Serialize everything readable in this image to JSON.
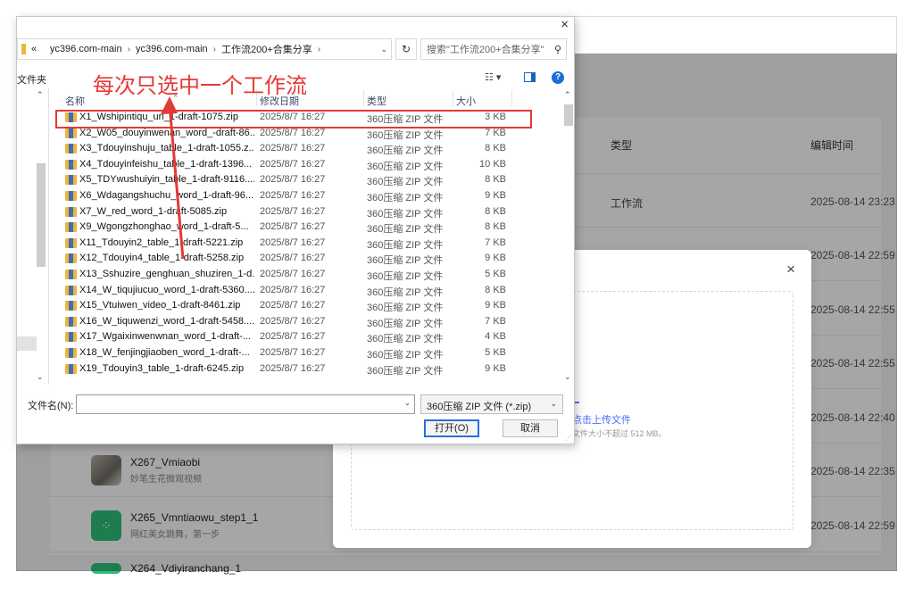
{
  "app": {
    "columns": {
      "type": "类型",
      "edit_time": "编辑时间"
    },
    "rows": [
      {
        "type": "工作流",
        "time": "2025-08-14 23:23"
      },
      {
        "type": "",
        "time": "2025-08-14 22:59"
      },
      {
        "type": "",
        "time": "2025-08-14 22:55"
      },
      {
        "type": "",
        "time": "2025-08-14 22:55"
      },
      {
        "type": "",
        "time": "2025-08-14 22:40"
      },
      {
        "type": "",
        "time": "2025-08-14 22:35"
      },
      {
        "type": "",
        "time": "2025-08-14 22:59"
      }
    ],
    "workflows": [
      {
        "title": "X267_Vmiaobi",
        "subtitle": "妙笔生花微观视频"
      },
      {
        "title": "X265_Vmntiaowu_step1_1",
        "subtitle": "网红美女跳舞，第一步"
      },
      {
        "title": "X264_Vdiyiranchang_1",
        "subtitle": ""
      }
    ]
  },
  "modal": {
    "close": "×",
    "upload_link": "点击上传文件",
    "upload_hint": "文件大小不超过 512 MB。"
  },
  "dialog": {
    "close": "×",
    "path": [
      "«",
      "yc396.com-main",
      "yc396.com-main",
      "工作流200+合集分享"
    ],
    "search_placeholder": "搜索\"工作流200+合集分享\"",
    "left_toolbar": "文件夹",
    "annotation": "每次只选中一个工作流",
    "headers": {
      "name": "名称",
      "date": "修改日期",
      "type": "类型",
      "size": "大小"
    },
    "files": [
      {
        "name": "X1_Wshipintiqu_url_1-draft-1075.zip",
        "date": "2025/8/7 16:27",
        "type": "360压缩 ZIP 文件",
        "size": "3 KB"
      },
      {
        "name": "X2_W05_douyinwenan_word_-draft-86...",
        "date": "2025/8/7 16:27",
        "type": "360压缩 ZIP 文件",
        "size": "7 KB"
      },
      {
        "name": "X3_Tdouyinshuju_table_1-draft-1055.z...",
        "date": "2025/8/7 16:27",
        "type": "360压缩 ZIP 文件",
        "size": "8 KB"
      },
      {
        "name": "X4_Tdouyinfeishu_table_1-draft-1396...",
        "date": "2025/8/7 16:27",
        "type": "360压缩 ZIP 文件",
        "size": "10 KB"
      },
      {
        "name": "X5_TDYwushuiyin_table_1-draft-9116....",
        "date": "2025/8/7 16:27",
        "type": "360压缩 ZIP 文件",
        "size": "8 KB"
      },
      {
        "name": "X6_Wdagangshuchu_word_1-draft-96...",
        "date": "2025/8/7 16:27",
        "type": "360压缩 ZIP 文件",
        "size": "9 KB"
      },
      {
        "name": "X7_W_red_word_1-draft-5085.zip",
        "date": "2025/8/7 16:27",
        "type": "360压缩 ZIP 文件",
        "size": "8 KB"
      },
      {
        "name": "X9_Wgongzhonghao_word_1-draft-5...",
        "date": "2025/8/7 16:27",
        "type": "360压缩 ZIP 文件",
        "size": "8 KB"
      },
      {
        "name": "X11_Tdouyin2_table_1-draft-5221.zip",
        "date": "2025/8/7 16:27",
        "type": "360压缩 ZIP 文件",
        "size": "7 KB"
      },
      {
        "name": "X12_Tdouyin4_table_1-draft-5258.zip",
        "date": "2025/8/7 16:27",
        "type": "360压缩 ZIP 文件",
        "size": "9 KB"
      },
      {
        "name": "X13_Sshuzire_genghuan_shuziren_1-d...",
        "date": "2025/8/7 16:27",
        "type": "360压缩 ZIP 文件",
        "size": "5 KB"
      },
      {
        "name": "X14_W_tiqujiucuo_word_1-draft-5360....",
        "date": "2025/8/7 16:27",
        "type": "360压缩 ZIP 文件",
        "size": "8 KB"
      },
      {
        "name": "X15_Vtuiwen_video_1-draft-8461.zip",
        "date": "2025/8/7 16:27",
        "type": "360压缩 ZIP 文件",
        "size": "9 KB"
      },
      {
        "name": "X16_W_tiquwenzi_word_1-draft-5458....",
        "date": "2025/8/7 16:27",
        "type": "360压缩 ZIP 文件",
        "size": "7 KB"
      },
      {
        "name": "X17_Wgaixinwenwnan_word_1-draft-...",
        "date": "2025/8/7 16:27",
        "type": "360压缩 ZIP 文件",
        "size": "4 KB"
      },
      {
        "name": "X18_W_fenjingjiaoben_word_1-draft-...",
        "date": "2025/8/7 16:27",
        "type": "360压缩 ZIP 文件",
        "size": "5 KB"
      },
      {
        "name": "X19_Tdouyin3_table_1-draft-6245.zip",
        "date": "2025/8/7 16:27",
        "type": "360压缩 ZIP 文件",
        "size": "9 KB"
      }
    ],
    "filename_label": "文件名(N):",
    "filename_value": "",
    "file_type": "360压缩 ZIP 文件 (*.zip)",
    "open_button": "打开(O)",
    "cancel_button": "取消"
  },
  "colors": {
    "annotation": "#e53935",
    "link": "#4a6cf7",
    "help": "#1b6fd8"
  }
}
